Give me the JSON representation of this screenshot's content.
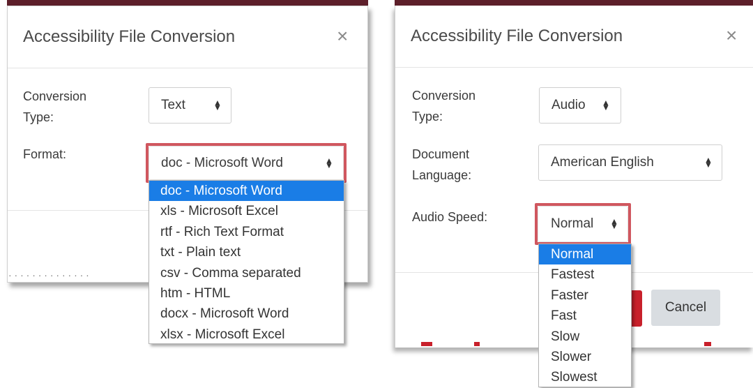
{
  "left_dialog": {
    "title": "Accessibility File Conversion",
    "close": "×",
    "conversion_type_label_1": "Conversion",
    "conversion_type_label_2": "Type:",
    "conversion_type_value": "Text",
    "format_label": "Format:",
    "format_value": "doc - Microsoft Word",
    "format_options": [
      "doc - Microsoft Word",
      "xls - Microsoft Excel",
      "rtf - Rich Text Format",
      "txt - Plain text",
      "csv - Comma separated",
      "htm - HTML",
      "docx - Microsoft Word",
      "xlsx - Microsoft Excel"
    ]
  },
  "right_dialog": {
    "title": "Accessibility File Conversion",
    "close": "×",
    "conversion_type_label_1": "Conversion",
    "conversion_type_label_2": "Type:",
    "conversion_type_value": "Audio",
    "language_label_1": "Document",
    "language_label_2": "Language:",
    "language_value": "American English",
    "speed_label": "Audio Speed:",
    "speed_value": "Normal",
    "speed_options": [
      "Normal",
      "Fastest",
      "Faster",
      "Fast",
      "Slow",
      "Slower",
      "Slowest"
    ],
    "cancel_label": "Cancel"
  },
  "arrow_up": "▲",
  "arrow_down": "▼",
  "colors": {
    "highlight": "#d0575f",
    "selected_option": "#1a7de6",
    "primary_button": "#c8202b",
    "cancel_button": "#d9dde1",
    "top_strip": "#5d1f2a"
  }
}
